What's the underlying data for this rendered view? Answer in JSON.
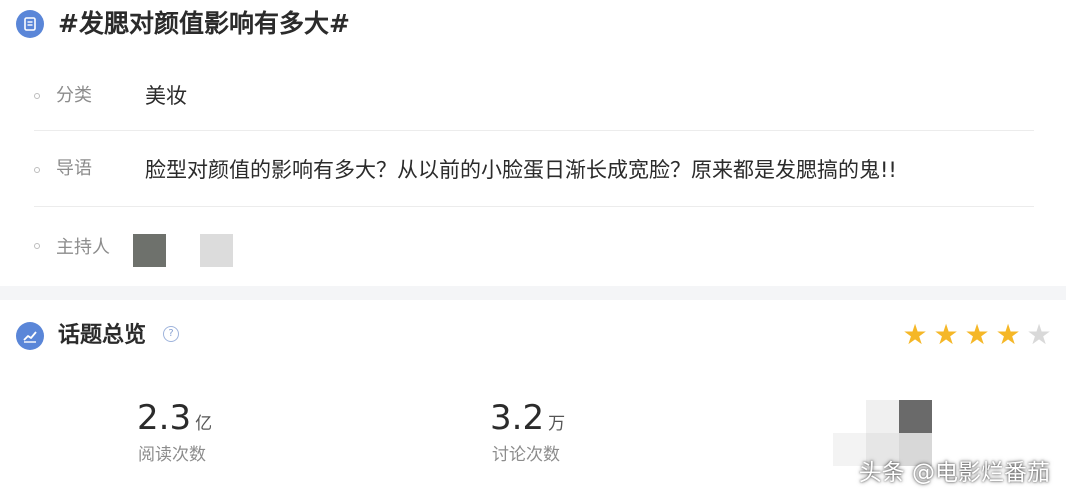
{
  "topic": {
    "title": "#发腮对颜值影响有多大#",
    "icon": "document-icon"
  },
  "info_rows": [
    {
      "label": "分类",
      "value": "美妆"
    },
    {
      "label": "导语",
      "value": "脸型对颜值的影响有多大？从以前的小脸蛋日渐长成宽脸？原来都是发腮搞的鬼!!"
    },
    {
      "label": "主持人",
      "value": ""
    }
  ],
  "overview": {
    "title": "话题总览",
    "help_glyph": "?",
    "rating": 4,
    "rating_max": 5,
    "colors": {
      "star_on": "#f5b727",
      "star_off": "#d9d9d9",
      "accent": "#5a86d8"
    }
  },
  "stats": [
    {
      "value": "2.3",
      "unit": "亿",
      "label": "阅读次数"
    },
    {
      "value": "3.2",
      "unit": "万",
      "label": "讨论次数"
    }
  ],
  "watermark": "头条 @电影烂番茄"
}
